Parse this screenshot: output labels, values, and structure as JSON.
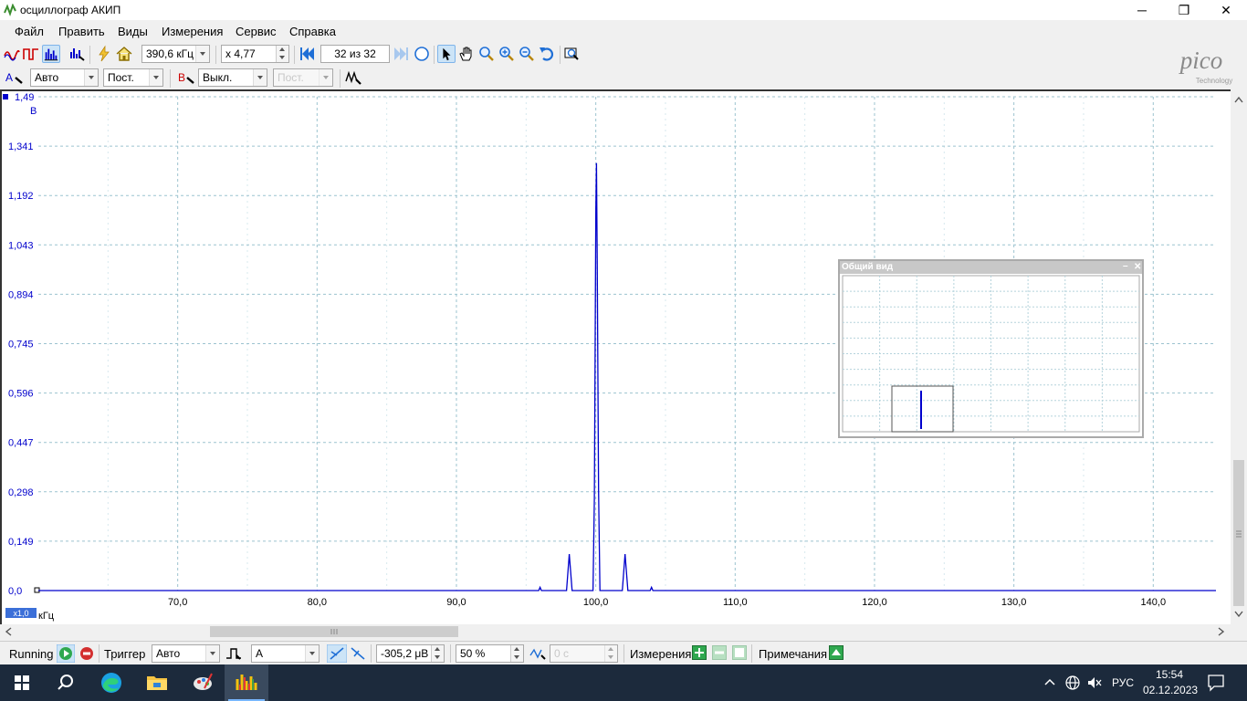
{
  "window": {
    "title": "осциллограф АКИП",
    "min_glyph": "─",
    "restore_glyph": "❐",
    "close_glyph": "✕"
  },
  "menu": [
    "Файл",
    "Править",
    "Виды",
    "Измерения",
    "Сервис",
    "Справка"
  ],
  "toolbar1": {
    "timebase": "390,6 кГц",
    "zoom": "x 4,77",
    "capture_counter": "32 из 32"
  },
  "toolbar2": {
    "channel_a_label": "A",
    "channel_a_range": "Авто",
    "channel_a_coupling": "Пост.",
    "channel_b_label": "B",
    "channel_b_range": "Выкл.",
    "channel_b_coupling": "Пост."
  },
  "logo": {
    "name": "pico",
    "sub": "Technology"
  },
  "chart_data": {
    "type": "line",
    "y_unit": "В",
    "x_unit": "кГц",
    "x_scale_badge": "x1,0",
    "y_ticks": [
      "1,49",
      "1,341",
      "1,192",
      "1,043",
      "0,894",
      "0,745",
      "0,596",
      "0,447",
      "0,298",
      "0,149",
      "0,0"
    ],
    "x_ticks": [
      "70,0",
      "80,0",
      "90,0",
      "100,0",
      "110,0",
      "120,0",
      "130,0",
      "140,0"
    ],
    "xlim": [
      60.0,
      144.5
    ],
    "ylim": [
      0.0,
      1.49
    ],
    "grid": true,
    "series": [
      {
        "color": "#0000cc",
        "x": [
          60,
          95.9,
          96.0,
          96.1,
          97.9,
          98.1,
          98.3,
          99.8,
          99.9,
          100.0,
          100.05,
          100.1,
          100.2,
          100.3,
          101.9,
          102.1,
          102.3,
          103.9,
          104.0,
          104.1,
          144.5
        ],
        "y": [
          0,
          0,
          0.01,
          0,
          0,
          0.11,
          0,
          0,
          0.28,
          1.15,
          1.29,
          1.0,
          0.3,
          0,
          0,
          0.11,
          0,
          0,
          0.01,
          0,
          0
        ]
      }
    ]
  },
  "overview": {
    "title": "Общий вид",
    "min_glyph": "–",
    "close_glyph": "✕"
  },
  "status": {
    "running": "Running",
    "trigger_label": "Триггер",
    "trigger_mode": "Авто",
    "trigger_channel": "A",
    "trigger_level": "-305,2 μВ",
    "pre_trigger": "50 %",
    "delay": "0 с",
    "measurements": "Измерения",
    "notes": "Примечания"
  },
  "taskbar": {
    "language": "РУС",
    "time": "15:54",
    "date": "02.12.2023"
  }
}
